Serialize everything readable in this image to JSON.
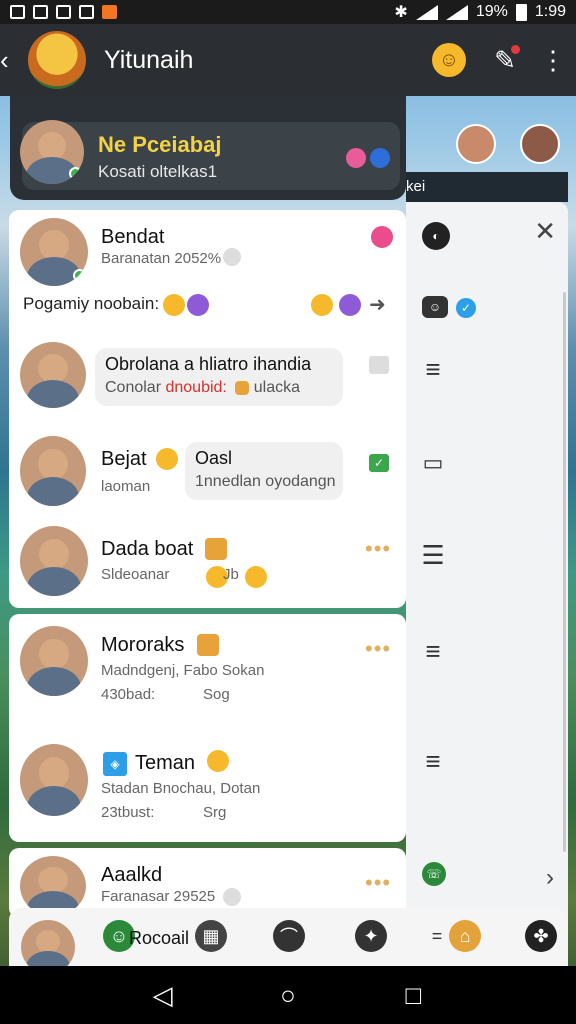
{
  "status_bar": {
    "battery": "19%",
    "time": "1:99"
  },
  "app_bar": {
    "title": "Yitunaih",
    "logo_text": "Yitunaih"
  },
  "right_panel": {
    "strip_label": "kei"
  },
  "pinned": {
    "name": "Ne Pceiabaj",
    "subtitle": "Kosati oltelkas1"
  },
  "chats": [
    {
      "name": "Bendat",
      "subtitle": "Baranatan 2052%",
      "reaction_text": "Pogamiy noobain:"
    },
    {
      "name": "",
      "bubble_line1": "Obrolana a hliatro ihandia",
      "bubble_line2_a": "Conolar",
      "bubble_line2_red": "dnoubid:",
      "bubble_line2_b": "ulacka"
    },
    {
      "name": "Bejat",
      "subtitle": "laoman",
      "bubble_line1": "Oasl",
      "bubble_line2": "1nnedlan oyodangn"
    },
    {
      "name": "Dada boat",
      "subtitle": "Sldeoanar",
      "extra": "Jb"
    },
    {
      "name": "Mororaks",
      "subtitle": "Madndgenj, Fabo Sokan",
      "subtitle2": "430bad:",
      "meta": "Sog"
    },
    {
      "name": "Teman",
      "subtitle": "Stadan Bnochau, Dotan",
      "subtitle2": "23tbust:",
      "meta": "Srg"
    },
    {
      "name": "Aaalkd",
      "subtitle": "Faranasar 29525"
    }
  ],
  "bottom_bar": {
    "label": "Rocoail"
  },
  "colors": {
    "app_bar": "#2b2f33",
    "accent_yellow": "#f3d246",
    "online": "#3cb54a"
  }
}
